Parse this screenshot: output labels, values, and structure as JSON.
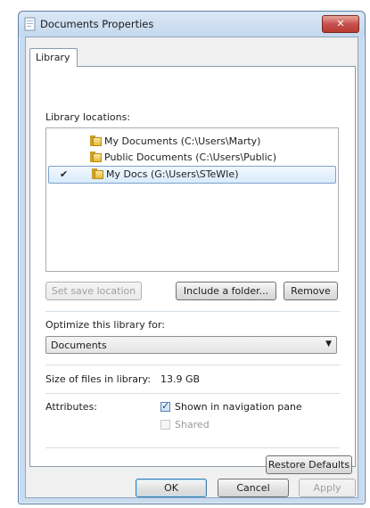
{
  "window": {
    "title": "Documents Properties",
    "close_label": "✕"
  },
  "tabs": [
    {
      "label": "Library"
    }
  ],
  "library": {
    "locations_label": "Library locations:",
    "locations": [
      {
        "text": "My Documents (C:\\Users\\Marty)",
        "checked": false,
        "selected": false
      },
      {
        "text": "Public Documents (C:\\Users\\Public)",
        "checked": false,
        "selected": false
      },
      {
        "text": "My Docs (G:\\Users\\STeWIe)",
        "checked": true,
        "selected": true
      }
    ],
    "check_glyph": "✔",
    "buttons": {
      "set_save_location": "Set save location",
      "include_folder": "Include a folder...",
      "remove": "Remove"
    },
    "optimize_label": "Optimize this library for:",
    "optimize_value": "Documents",
    "size_label": "Size of files in library:",
    "size_value": "13.9 GB",
    "attributes_label": "Attributes:",
    "attributes": [
      {
        "label": "Shown in navigation pane",
        "checked": true,
        "enabled": true
      },
      {
        "label": "Shared",
        "checked": false,
        "enabled": false
      }
    ],
    "restore_defaults": "Restore Defaults"
  },
  "footer": {
    "ok": "OK",
    "cancel": "Cancel",
    "apply": "Apply"
  }
}
